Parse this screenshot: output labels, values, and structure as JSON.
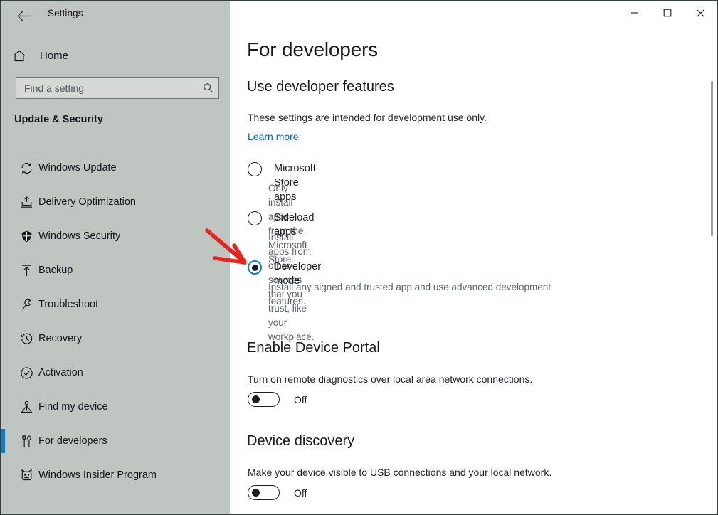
{
  "window": {
    "app_title": "Settings",
    "back_icon": "back-arrow-icon",
    "controls": {
      "minimize_label": "Minimize",
      "maximize_label": "Maximize",
      "close_label": "Close"
    }
  },
  "sidebar": {
    "home_label": "Home",
    "home_icon": "home-icon",
    "search": {
      "placeholder": "Find a setting",
      "value": "",
      "icon": "search-icon"
    },
    "category_title": "Update & Security",
    "accent_color": "#0a7cd4",
    "background_color": "#bfc5c0",
    "items": [
      {
        "label": "Windows Update",
        "icon": "sync-refresh-icon",
        "selected": false
      },
      {
        "label": "Delivery Optimization",
        "icon": "delivery-upload-icon",
        "selected": false
      },
      {
        "label": "Windows Security",
        "icon": "shield-icon",
        "selected": false
      },
      {
        "label": "Backup",
        "icon": "upload-arrow-icon",
        "selected": false
      },
      {
        "label": "Troubleshoot",
        "icon": "wrench-icon",
        "selected": false
      },
      {
        "label": "Recovery",
        "icon": "history-clock-icon",
        "selected": false
      },
      {
        "label": "Activation",
        "icon": "check-circle-icon",
        "selected": false
      },
      {
        "label": "Find my device",
        "icon": "location-person-icon",
        "selected": false
      },
      {
        "label": "For developers",
        "icon": "dev-tools-icon",
        "selected": true
      },
      {
        "label": "Windows Insider Program",
        "icon": "ninjacat-icon",
        "selected": false
      }
    ]
  },
  "main": {
    "page_title": "For developers",
    "developer_features": {
      "heading": "Use developer features",
      "description": "These settings are intended for development use only.",
      "learn_more_label": "Learn more",
      "learn_more_color": "#0267c1",
      "options": [
        {
          "label": "Microsoft Store apps",
          "description": "Only install apps from the Microsoft Store.",
          "checked": false
        },
        {
          "label": "Sideload apps",
          "description": "Install apps from other sources that you trust, like your workplace.",
          "checked": false
        },
        {
          "label": "Developer mode",
          "description": "Install any signed and trusted app and use advanced development features.",
          "checked": true
        }
      ]
    },
    "device_portal": {
      "heading": "Enable Device Portal",
      "description": "Turn on remote diagnostics over local area network connections.",
      "toggle_state": "Off"
    },
    "device_discovery": {
      "heading": "Device discovery",
      "description": "Make your device visible to USB connections and your local network.",
      "toggle_state": "Off"
    }
  },
  "annotation": {
    "arrow_color": "#e8241f",
    "points_to": "Developer mode"
  }
}
